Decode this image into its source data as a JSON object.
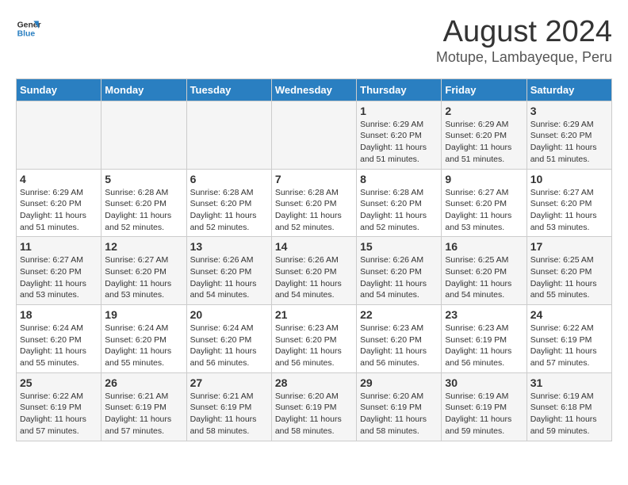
{
  "logo": {
    "line1": "General",
    "line2": "Blue"
  },
  "title": "August 2024",
  "subtitle": "Motupe, Lambayeque, Peru",
  "days_of_week": [
    "Sunday",
    "Monday",
    "Tuesday",
    "Wednesday",
    "Thursday",
    "Friday",
    "Saturday"
  ],
  "weeks": [
    [
      {
        "day": "",
        "info": ""
      },
      {
        "day": "",
        "info": ""
      },
      {
        "day": "",
        "info": ""
      },
      {
        "day": "",
        "info": ""
      },
      {
        "day": "1",
        "info": "Sunrise: 6:29 AM\nSunset: 6:20 PM\nDaylight: 11 hours\nand 51 minutes."
      },
      {
        "day": "2",
        "info": "Sunrise: 6:29 AM\nSunset: 6:20 PM\nDaylight: 11 hours\nand 51 minutes."
      },
      {
        "day": "3",
        "info": "Sunrise: 6:29 AM\nSunset: 6:20 PM\nDaylight: 11 hours\nand 51 minutes."
      }
    ],
    [
      {
        "day": "4",
        "info": "Sunrise: 6:29 AM\nSunset: 6:20 PM\nDaylight: 11 hours\nand 51 minutes."
      },
      {
        "day": "5",
        "info": "Sunrise: 6:28 AM\nSunset: 6:20 PM\nDaylight: 11 hours\nand 52 minutes."
      },
      {
        "day": "6",
        "info": "Sunrise: 6:28 AM\nSunset: 6:20 PM\nDaylight: 11 hours\nand 52 minutes."
      },
      {
        "day": "7",
        "info": "Sunrise: 6:28 AM\nSunset: 6:20 PM\nDaylight: 11 hours\nand 52 minutes."
      },
      {
        "day": "8",
        "info": "Sunrise: 6:28 AM\nSunset: 6:20 PM\nDaylight: 11 hours\nand 52 minutes."
      },
      {
        "day": "9",
        "info": "Sunrise: 6:27 AM\nSunset: 6:20 PM\nDaylight: 11 hours\nand 53 minutes."
      },
      {
        "day": "10",
        "info": "Sunrise: 6:27 AM\nSunset: 6:20 PM\nDaylight: 11 hours\nand 53 minutes."
      }
    ],
    [
      {
        "day": "11",
        "info": "Sunrise: 6:27 AM\nSunset: 6:20 PM\nDaylight: 11 hours\nand 53 minutes."
      },
      {
        "day": "12",
        "info": "Sunrise: 6:27 AM\nSunset: 6:20 PM\nDaylight: 11 hours\nand 53 minutes."
      },
      {
        "day": "13",
        "info": "Sunrise: 6:26 AM\nSunset: 6:20 PM\nDaylight: 11 hours\nand 54 minutes."
      },
      {
        "day": "14",
        "info": "Sunrise: 6:26 AM\nSunset: 6:20 PM\nDaylight: 11 hours\nand 54 minutes."
      },
      {
        "day": "15",
        "info": "Sunrise: 6:26 AM\nSunset: 6:20 PM\nDaylight: 11 hours\nand 54 minutes."
      },
      {
        "day": "16",
        "info": "Sunrise: 6:25 AM\nSunset: 6:20 PM\nDaylight: 11 hours\nand 54 minutes."
      },
      {
        "day": "17",
        "info": "Sunrise: 6:25 AM\nSunset: 6:20 PM\nDaylight: 11 hours\nand 55 minutes."
      }
    ],
    [
      {
        "day": "18",
        "info": "Sunrise: 6:24 AM\nSunset: 6:20 PM\nDaylight: 11 hours\nand 55 minutes."
      },
      {
        "day": "19",
        "info": "Sunrise: 6:24 AM\nSunset: 6:20 PM\nDaylight: 11 hours\nand 55 minutes."
      },
      {
        "day": "20",
        "info": "Sunrise: 6:24 AM\nSunset: 6:20 PM\nDaylight: 11 hours\nand 56 minutes."
      },
      {
        "day": "21",
        "info": "Sunrise: 6:23 AM\nSunset: 6:20 PM\nDaylight: 11 hours\nand 56 minutes."
      },
      {
        "day": "22",
        "info": "Sunrise: 6:23 AM\nSunset: 6:20 PM\nDaylight: 11 hours\nand 56 minutes."
      },
      {
        "day": "23",
        "info": "Sunrise: 6:23 AM\nSunset: 6:19 PM\nDaylight: 11 hours\nand 56 minutes."
      },
      {
        "day": "24",
        "info": "Sunrise: 6:22 AM\nSunset: 6:19 PM\nDaylight: 11 hours\nand 57 minutes."
      }
    ],
    [
      {
        "day": "25",
        "info": "Sunrise: 6:22 AM\nSunset: 6:19 PM\nDaylight: 11 hours\nand 57 minutes."
      },
      {
        "day": "26",
        "info": "Sunrise: 6:21 AM\nSunset: 6:19 PM\nDaylight: 11 hours\nand 57 minutes."
      },
      {
        "day": "27",
        "info": "Sunrise: 6:21 AM\nSunset: 6:19 PM\nDaylight: 11 hours\nand 58 minutes."
      },
      {
        "day": "28",
        "info": "Sunrise: 6:20 AM\nSunset: 6:19 PM\nDaylight: 11 hours\nand 58 minutes."
      },
      {
        "day": "29",
        "info": "Sunrise: 6:20 AM\nSunset: 6:19 PM\nDaylight: 11 hours\nand 58 minutes."
      },
      {
        "day": "30",
        "info": "Sunrise: 6:19 AM\nSunset: 6:19 PM\nDaylight: 11 hours\nand 59 minutes."
      },
      {
        "day": "31",
        "info": "Sunrise: 6:19 AM\nSunset: 6:18 PM\nDaylight: 11 hours\nand 59 minutes."
      }
    ]
  ]
}
